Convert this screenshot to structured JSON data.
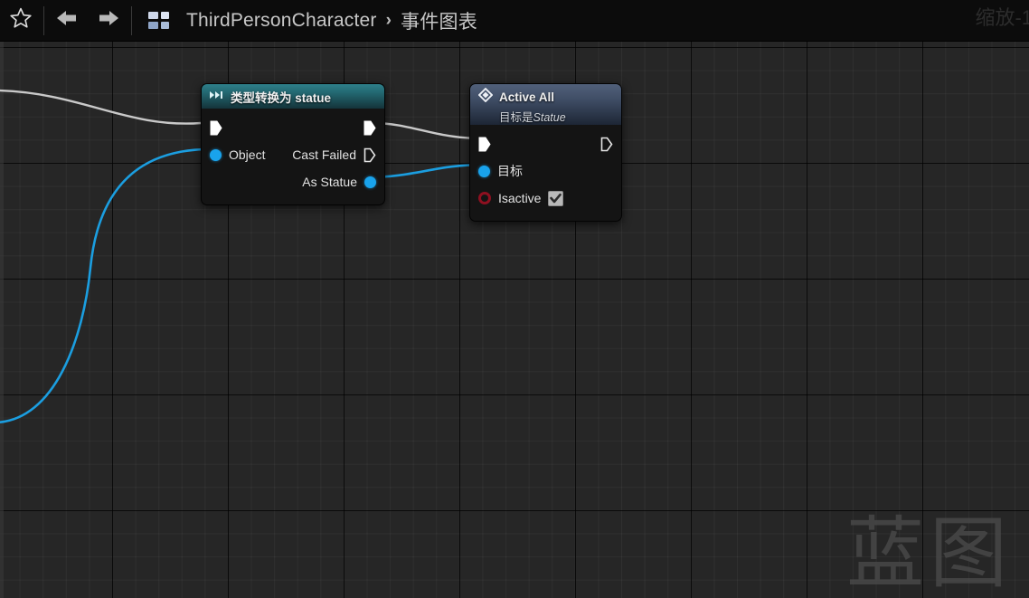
{
  "toolbar": {
    "favorite_icon": "star-icon",
    "back_icon": "arrow-left-icon",
    "forward_icon": "arrow-right-icon",
    "asset_icon": "blueprint-asset-icon",
    "breadcrumb": {
      "root": "ThirdPersonCharacter",
      "separator": "›",
      "current": "事件图表"
    },
    "zoom_label": "缩放-1"
  },
  "canvas": {
    "watermark": "蓝图",
    "background_color": "#262626",
    "grid_minor_color": "#2f2f2f",
    "grid_major_color": "#000000"
  },
  "colors": {
    "exec_wire": "#c9c9c9",
    "object_wire": "#1b9ee0",
    "object_pin": "#19a3ec",
    "bool_pin": "#8e1020",
    "cast_header": "#2e7f8a",
    "call_header": "#51607a"
  },
  "nodes": [
    {
      "id": "cast-node",
      "icon": "cast-arrows-icon",
      "title": "类型转换为 statue",
      "subtitle": "",
      "pins": [
        {
          "side": "left",
          "type": "exec",
          "label": "",
          "connected": true
        },
        {
          "side": "right",
          "type": "exec",
          "label": "",
          "connected": true
        },
        {
          "side": "left",
          "type": "object",
          "label": "Object",
          "connected": true
        },
        {
          "side": "right",
          "type": "exec",
          "label": "Cast Failed",
          "connected": false
        },
        {
          "side": "right",
          "type": "object",
          "label": "As Statue",
          "connected": true
        }
      ]
    },
    {
      "id": "active-all-node",
      "icon": "function-diamond-icon",
      "title": "Active All",
      "subtitle_prefix": "目标是",
      "subtitle_target": "Statue",
      "pins": [
        {
          "side": "left",
          "type": "exec",
          "label": "",
          "connected": true
        },
        {
          "side": "right",
          "type": "exec",
          "label": "",
          "connected": false
        },
        {
          "side": "left",
          "type": "object",
          "label": "目标",
          "connected": true
        },
        {
          "side": "left",
          "type": "bool",
          "label": "Isactive",
          "connected": false,
          "checkbox": true,
          "checked": true
        }
      ]
    }
  ],
  "wires": [
    {
      "name": "exec-wire-into-cast",
      "type": "exec"
    },
    {
      "name": "object-wire-into-cast",
      "type": "object"
    },
    {
      "name": "exec-wire-cast-to-active",
      "type": "exec"
    },
    {
      "name": "object-wire-cast-to-active",
      "type": "object"
    }
  ]
}
